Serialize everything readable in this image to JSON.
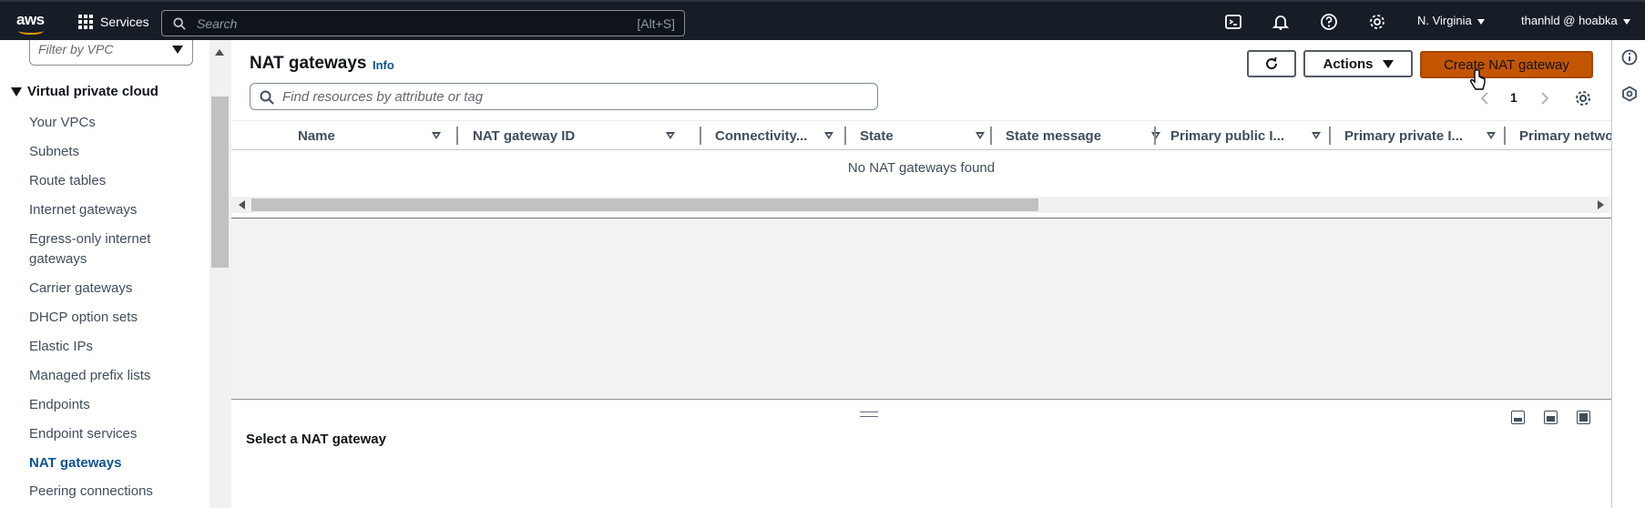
{
  "topnav": {
    "logo_text": "aws",
    "services_label": "Services",
    "search_placeholder": "Search",
    "search_shortcut": "[Alt+S]",
    "region": "N. Virginia",
    "user": "thanhld @ hoabka"
  },
  "sidebar": {
    "filter_placeholder": "Filter by VPC",
    "section_title": "Virtual private cloud",
    "items": [
      {
        "label": "Your VPCs"
      },
      {
        "label": "Subnets"
      },
      {
        "label": "Route tables"
      },
      {
        "label": "Internet gateways"
      },
      {
        "label": "Egress-only internet gateways"
      },
      {
        "label": "Carrier gateways"
      },
      {
        "label": "DHCP option sets"
      },
      {
        "label": "Elastic IPs"
      },
      {
        "label": "Managed prefix lists"
      },
      {
        "label": "Endpoints"
      },
      {
        "label": "Endpoint services"
      },
      {
        "label": "NAT gateways"
      },
      {
        "label": "Peering connections"
      }
    ],
    "active_item": "NAT gateways"
  },
  "main": {
    "title": "NAT gateways",
    "info_label": "Info",
    "actions_label": "Actions",
    "create_label": "Create NAT gateway",
    "filter_placeholder": "Find resources by attribute or tag",
    "page_number": "1",
    "columns": [
      "Name",
      "NAT gateway ID",
      "Connectivity...",
      "State",
      "State message",
      "Primary public I...",
      "Primary private I...",
      "Primary netwo"
    ],
    "empty_message": "No NAT gateways found",
    "detail_title": "Select a NAT gateway"
  },
  "colors": {
    "nav_bg": "#161d26",
    "primary_button": "#c45500",
    "link": "#0b5394",
    "panel_gray": "#f2f2f3"
  },
  "icons": [
    "grid-icon",
    "search-icon",
    "cloudshell-icon",
    "bell-icon",
    "help-icon",
    "settings-icon",
    "refresh-icon",
    "info-circle-icon",
    "feedback-icon"
  ]
}
